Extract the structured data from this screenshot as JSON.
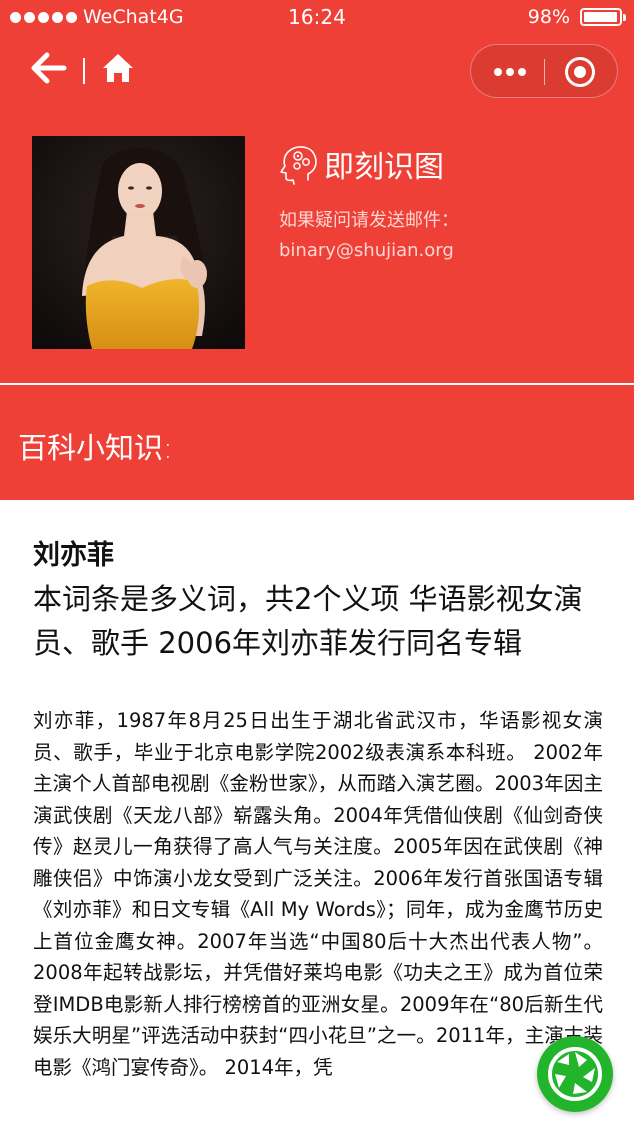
{
  "status_bar": {
    "carrier": "WeChat4G",
    "time": "16:24",
    "battery": "98%",
    "battery_level": 0.98
  },
  "nav": {
    "back_icon": "arrow-left-icon",
    "home_icon": "home-icon",
    "more_icon": "more-dots-icon",
    "close_icon": "target-close-icon"
  },
  "header": {
    "brand_title": "即刻识图",
    "brand_icon": "brain-gears-icon",
    "contact_line1": "如果疑问请发送邮件：",
    "contact_line2": "binary@shujian.org"
  },
  "wiki": {
    "label": "百科小知识:"
  },
  "article": {
    "title": "刘亦菲",
    "subtitle": "本词条是多义词，共2个义项 华语影视女演员、歌手 2006年刘亦菲发行同名专辑",
    "description": "刘亦菲，1987年8月25日出生于湖北省武汉市，华语影视女演员、歌手，毕业于北京电影学院2002级表演系本科班。 2002年主演个人首部电视剧《金粉世家》，从而踏入演艺圈。2003年因主演武侠剧《天龙八部》崭露头角。2004年凭借仙侠剧《仙剑奇侠传》赵灵儿一角获得了高人气与关注度。2005年因在武侠剧《神雕侠侣》中饰演小龙女受到广泛关注。2006年发行首张国语专辑《刘亦菲》和日文专辑《All My Words》；同年，成为金鹰节历史上首位金鹰女神。2007年当选“中国80后十大杰出代表人物”。2008年起转战影坛，并凭借好莱坞电影《功夫之王》成为首位荣登IMDB电影新人排行榜榜首的亚洲女星。2009年在“80后新生代娱乐大明星”评选活动中获封“四小花旦”之一。2011年，主演古装电影《鸿门宴传奇》。 2014年，凭"
  },
  "fab": {
    "icon": "camera-shutter-icon"
  },
  "colors": {
    "brand_red": "#ee4036",
    "fab_green": "#22b52b"
  }
}
